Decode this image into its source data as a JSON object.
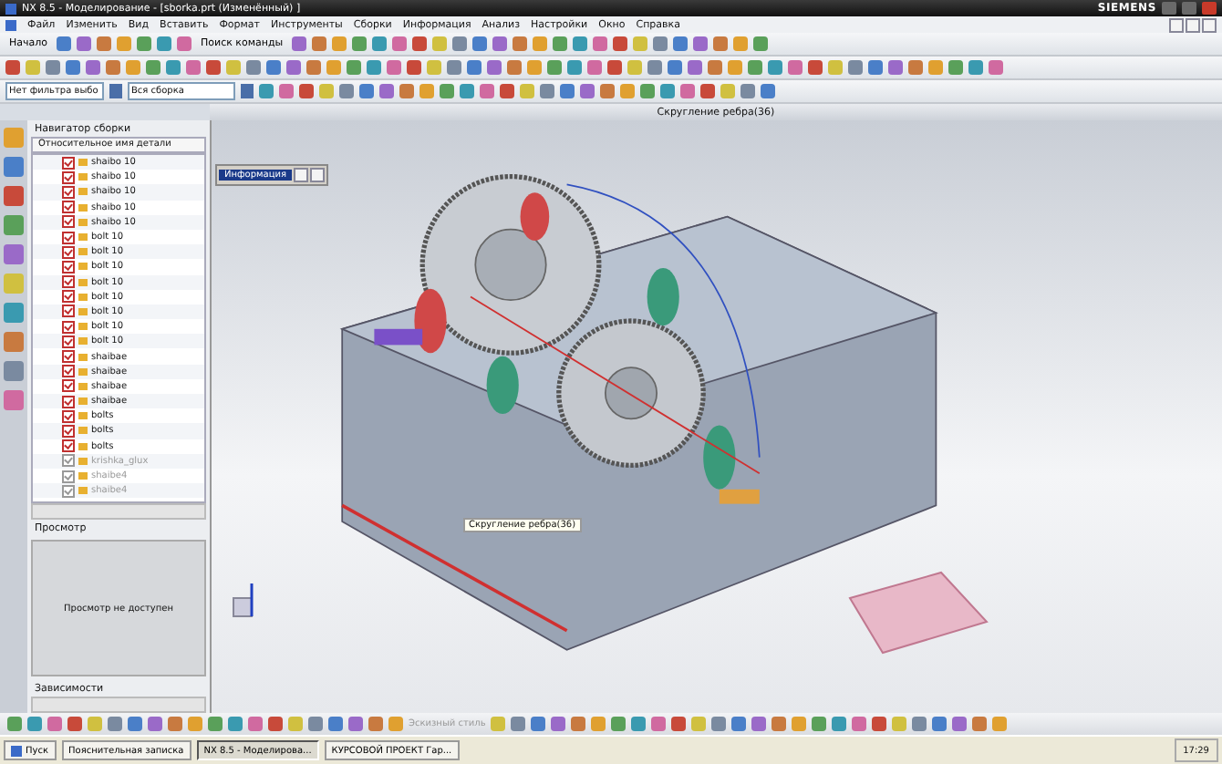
{
  "window": {
    "title": "NX 8.5 - Моделирование - [sborka.prt (Изменённый) ]",
    "brand": "SIEMENS"
  },
  "menu": [
    "Файл",
    "Изменить",
    "Вид",
    "Вставить",
    "Формат",
    "Инструменты",
    "Сборки",
    "Информация",
    "Анализ",
    "Настройки",
    "Окно",
    "Справка"
  ],
  "toolbar": {
    "start_button": "Начало",
    "command_search": "Поиск команды"
  },
  "selection_bar": {
    "filter": "Нет фильтра выбо",
    "scope": "Вся сборка"
  },
  "viewport": {
    "title": "Скругление ребра(36)",
    "tooltip": "Скругление ребра(36)",
    "info_window": "Информация"
  },
  "navigator": {
    "title": "Навигатор сборки",
    "column": "Относительное имя детали",
    "rows": [
      {
        "name": "shaibo 10",
        "disabled": false
      },
      {
        "name": "shaibo 10",
        "disabled": false
      },
      {
        "name": "shaibo 10",
        "disabled": false
      },
      {
        "name": "shaibo 10",
        "disabled": false
      },
      {
        "name": "shaibo 10",
        "disabled": false
      },
      {
        "name": "bolt 10",
        "disabled": false
      },
      {
        "name": "bolt 10",
        "disabled": false
      },
      {
        "name": "bolt 10",
        "disabled": false
      },
      {
        "name": "bolt 10",
        "disabled": false
      },
      {
        "name": "bolt 10",
        "disabled": false
      },
      {
        "name": "bolt 10",
        "disabled": false
      },
      {
        "name": "bolt 10",
        "disabled": false
      },
      {
        "name": "bolt 10",
        "disabled": false
      },
      {
        "name": "shaibae",
        "disabled": false
      },
      {
        "name": "shaibae",
        "disabled": false
      },
      {
        "name": "shaibae",
        "disabled": false
      },
      {
        "name": "shaibae",
        "disabled": false
      },
      {
        "name": "bolts",
        "disabled": false
      },
      {
        "name": "bolts",
        "disabled": false
      },
      {
        "name": "bolts",
        "disabled": false
      },
      {
        "name": "krishka_glux",
        "disabled": true
      },
      {
        "name": "shaibe4",
        "disabled": true
      },
      {
        "name": "shaibe4",
        "disabled": true
      }
    ]
  },
  "preview": {
    "title": "Просмотр",
    "message": "Просмотр не доступен"
  },
  "dependencies": {
    "title": "Зависимости"
  },
  "bottom_toolbar": {
    "sketch_style": "Эскизный стиль"
  },
  "taskbar": {
    "start": "Пуск",
    "tasks": [
      {
        "label": "Пояснительная записка",
        "selected": false
      },
      {
        "label": "NX 8.5 - Моделирова...",
        "selected": true
      },
      {
        "label": "КУРСОВОЙ ПРОЕКТ Гар...",
        "selected": false
      }
    ],
    "clock": "17:29"
  }
}
